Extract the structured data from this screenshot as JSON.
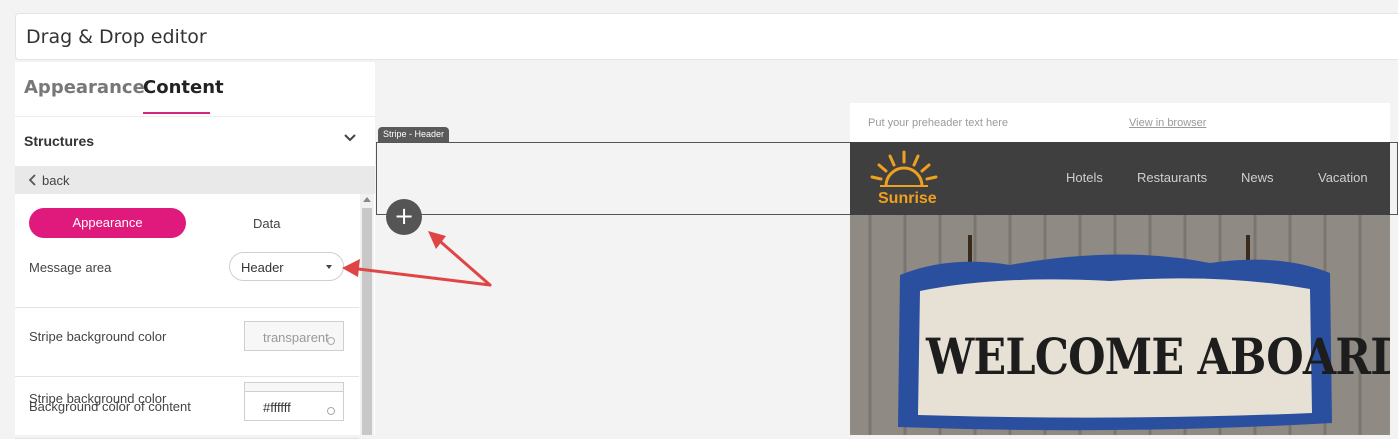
{
  "window": {
    "title": "Drag & Drop editor"
  },
  "tabs": [
    {
      "label": "Appearance"
    },
    {
      "label": "Content"
    }
  ],
  "structures": {
    "label": "Structures"
  },
  "back": {
    "label": "back"
  },
  "settings": {
    "subtabs": {
      "appearance": "Appearance",
      "data": "Data"
    },
    "message_area": {
      "label": "Message area",
      "value": "Header"
    },
    "stripe_bg": {
      "label": "Stripe background color",
      "value": "transparent"
    },
    "content_bg": {
      "label": "Background color of content",
      "value": "#ffffff"
    }
  },
  "canvas": {
    "stripe_tag": "Stripe - Header",
    "add_button": "+",
    "preheader": {
      "text": "Put your preheader text here",
      "link": "View in browser"
    },
    "logo_text": "Sunrise",
    "nav": [
      "Hotels",
      "Restaurants",
      "News",
      "Vacation"
    ],
    "hero_text": "WELCOME ABOARD"
  },
  "colors": {
    "accent": "#e0197d",
    "header_bg": "#3f3f3f",
    "annotation_arrow": "#e04545",
    "logo": "#f0a020"
  }
}
